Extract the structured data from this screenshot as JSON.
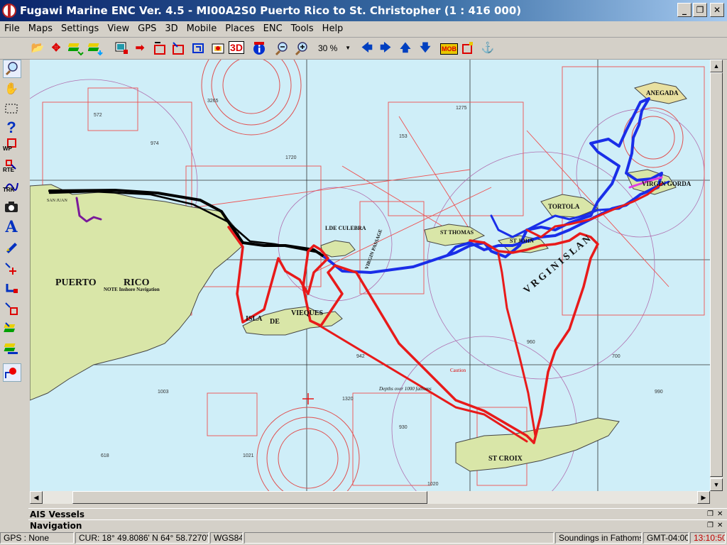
{
  "window": {
    "title": "Fugawi Marine ENC Ver. 4.5 - MI00A2S0  Puerto Rico to St. Christopher  (1 : 416 000)",
    "minimize": "_",
    "restore": "❐",
    "close": "✕"
  },
  "menu": [
    "File",
    "Maps",
    "Settings",
    "View",
    "GPS",
    "3D",
    "Mobile",
    "Places",
    "ENC",
    "Tools",
    "Help"
  ],
  "toolbar": {
    "zoom_value": "30 %",
    "mob_label": "MOB",
    "three_d_label": "3D"
  },
  "left_toolbar": {
    "wp_label": "WP",
    "rte_label": "RTE",
    "trk_label": "TRK"
  },
  "map": {
    "labels": {
      "puerto_rico": "PUERTO",
      "rico": "RICO",
      "isla": "ISLA",
      "de": "DE",
      "vieques": "VIEQUES",
      "st_croix": "ST CROIX",
      "tortola": "TORTOLA",
      "virgin_gorda": "VIRGIN GORDA",
      "anegada": "ANEGADA",
      "st_john": "ST JOHN",
      "st_thomas": "ST THOMAS",
      "isla_de_culebra": "LDE CULEBRA",
      "virgin_passage": "VIRGIN PASSAGE",
      "san_juan": "SAN JUAN",
      "note_title": "NOTE Inshore Navigation",
      "caution": "Caution",
      "depths_1000": "Depths over 1000 fathoms",
      "virgin_islands": "V  R  G  I  N     I  S  L  A  N"
    }
  },
  "panels": {
    "ais": "AIS Vessels",
    "navigation": "Navigation"
  },
  "status": {
    "gps": "GPS : None",
    "cursor": "CUR: 18° 49.8086' N 64° 58.7270' W",
    "datum": "WGS84",
    "soundings": "Soundings in Fathoms",
    "timezone": "GMT-04:00",
    "clock": "13:10:50"
  },
  "colors": {
    "sea": "#cfeef8",
    "land": "#d9e6a8",
    "track_blue": "#1a2ee8",
    "track_red": "#e81a1a",
    "track_black": "#000000",
    "clock_red": "#c00000"
  }
}
